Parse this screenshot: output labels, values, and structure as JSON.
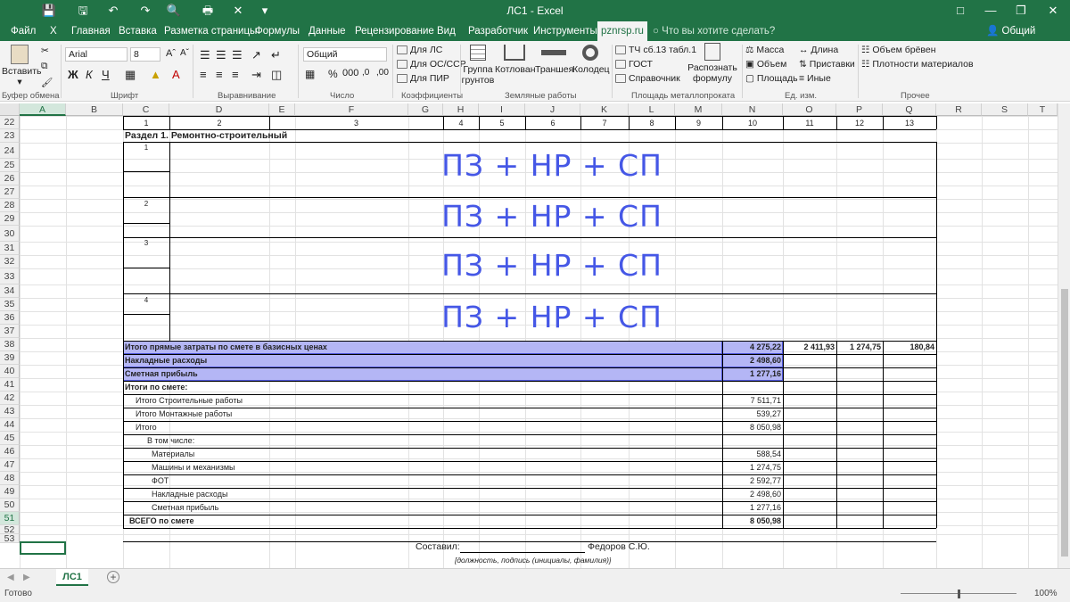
{
  "window": {
    "title": "ЛС1 - Excel"
  },
  "menu": {
    "tabs": [
      "Файл",
      "Главная",
      "Вставка",
      "Разметка страницы",
      "Формулы",
      "Данные",
      "Рецензирование",
      "Вид",
      "Разработчик",
      "Инструменты",
      "pznrsp.ru"
    ],
    "active_tab": "pznrsp.ru",
    "tell_me": "Что вы хотите сделать?",
    "share": "Общий доступ"
  },
  "ribbon": {
    "paste": "Вставить",
    "font_name": "Arial",
    "font_size": "8",
    "number_format": "Общий",
    "coef": [
      "Для ЛС",
      "Для ОС/ССР",
      "Для ПИР"
    ],
    "earth": [
      "Группа грунтов",
      "Котлован",
      "Траншея",
      "Колодец"
    ],
    "tch": "ТЧ сб.13 табл.1",
    "gost": "ГОСТ",
    "spravochnik": "Справочник",
    "recognize": "Распознать формулу",
    "units": [
      "Масса",
      "Объем",
      "Площадь",
      "Длина",
      "Приставки",
      "Иные"
    ],
    "other": [
      "Объем брёвен",
      "Плотности материалов"
    ],
    "groups": [
      "Буфер обмена",
      "Шрифт",
      "Выравнивание",
      "Число",
      "Коэффициенты",
      "Земляные работы",
      "Площадь металлопроката",
      "Ед. изм.",
      "Прочее"
    ]
  },
  "sheet": {
    "columns": [
      "A",
      "B",
      "C",
      "D",
      "E",
      "F",
      "G",
      "H",
      "I",
      "J",
      "K",
      "L",
      "M",
      "N",
      "O",
      "P",
      "Q",
      "R",
      "S",
      "T"
    ],
    "rows": [
      "22",
      "23",
      "24",
      "25",
      "26",
      "27",
      "28",
      "29",
      "30",
      "31",
      "32",
      "33",
      "34",
      "35",
      "36",
      "37",
      "38",
      "39",
      "40",
      "41",
      "42",
      "43",
      "44",
      "45",
      "46",
      "47",
      "48",
      "49",
      "50",
      "51",
      "52",
      "53"
    ],
    "header_nums": [
      "1",
      "2",
      "3",
      "4",
      "5",
      "6",
      "7",
      "8",
      "9",
      "10",
      "11",
      "12",
      "13"
    ],
    "section_title": "Раздел 1. Ремонтно-строительный",
    "item_numbers": [
      "1",
      "2",
      "3",
      "4"
    ],
    "formula_text": "ПЗ + НР + СП",
    "totals": [
      {
        "label": "Итого прямые затраты по смете в базисных ценах",
        "n": "4 275,22",
        "o": "2 411,93",
        "p": "1 274,75",
        "q": "180,84"
      },
      {
        "label": "Накладные расходы",
        "n": "2 498,60"
      },
      {
        "label": "Сметная прибыль",
        "n": "1 277,16"
      }
    ],
    "summary_title": "Итоги по смете:",
    "summary": [
      {
        "label": "Итого Строительные работы",
        "n": "7 511,71"
      },
      {
        "label": "Итого Монтажные работы",
        "n": "539,27"
      },
      {
        "label": "Итого",
        "n": "8 050,98"
      },
      {
        "label": "В том числе:",
        "n": ""
      },
      {
        "label": "Материалы",
        "n": "588,54"
      },
      {
        "label": "Машины и механизмы",
        "n": "1 274,75"
      },
      {
        "label": "ФОТ",
        "n": "2 592,77"
      },
      {
        "label": "Накладные расходы",
        "n": "2 498,60"
      },
      {
        "label": "Сметная прибыль",
        "n": "1 277,16"
      }
    ],
    "grand_total": {
      "label": "ВСЕГО по смете",
      "n": "8 050,98"
    },
    "signed_label": "Составил:",
    "signer": "Федоров С.Ю.",
    "sign_hint": "[должность, подпись (инициалы, фамилия)]"
  },
  "tabs": {
    "sheet": "ЛС1"
  },
  "status": {
    "ready": "Готово",
    "zoom": "100%"
  }
}
